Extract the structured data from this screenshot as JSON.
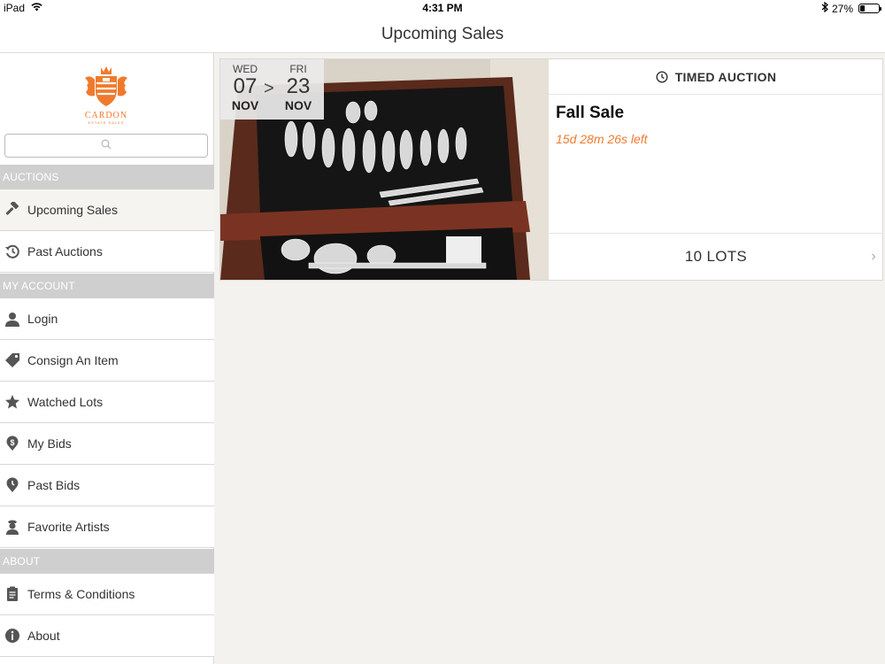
{
  "status": {
    "device": "iPad",
    "time": "4:31 PM",
    "battery": "27%",
    "battery_level": 0.27
  },
  "header": {
    "title": "Upcoming Sales"
  },
  "brand": {
    "name": "CARDON",
    "tagline": "ESTATE SALES",
    "color": "#f07a2c"
  },
  "search": {
    "placeholder": "",
    "icon": "search-icon"
  },
  "sidebar": {
    "sections": [
      {
        "title": "AUCTIONS",
        "items": [
          {
            "label": "Upcoming Sales",
            "icon": "gavel-icon",
            "active": true
          },
          {
            "label": "Past Auctions",
            "icon": "history-icon"
          }
        ]
      },
      {
        "title": "MY ACCOUNT",
        "items": [
          {
            "label": "Login",
            "icon": "user-icon"
          },
          {
            "label": "Consign An Item",
            "icon": "tag-icon"
          },
          {
            "label": "Watched Lots",
            "icon": "star-icon"
          },
          {
            "label": "My Bids",
            "icon": "dollar-pin-icon"
          },
          {
            "label": "Past Bids",
            "icon": "clock-pin-icon"
          },
          {
            "label": "Favorite Artists",
            "icon": "artist-icon"
          }
        ]
      },
      {
        "title": "ABOUT",
        "items": [
          {
            "label": "Terms & Conditions",
            "icon": "document-icon"
          },
          {
            "label": "About",
            "icon": "info-icon"
          }
        ]
      }
    ]
  },
  "sale": {
    "start": {
      "day": "WED",
      "date": "07",
      "month": "NOV"
    },
    "arrow": ">",
    "end": {
      "day": "FRI",
      "date": "23",
      "month": "NOV"
    },
    "type": "TIMED AUCTION",
    "title": "Fall Sale",
    "time_left": "15d 28m 26s left",
    "lots": "10 LOTS",
    "chevron": "›",
    "accent": "#f07a2c"
  }
}
